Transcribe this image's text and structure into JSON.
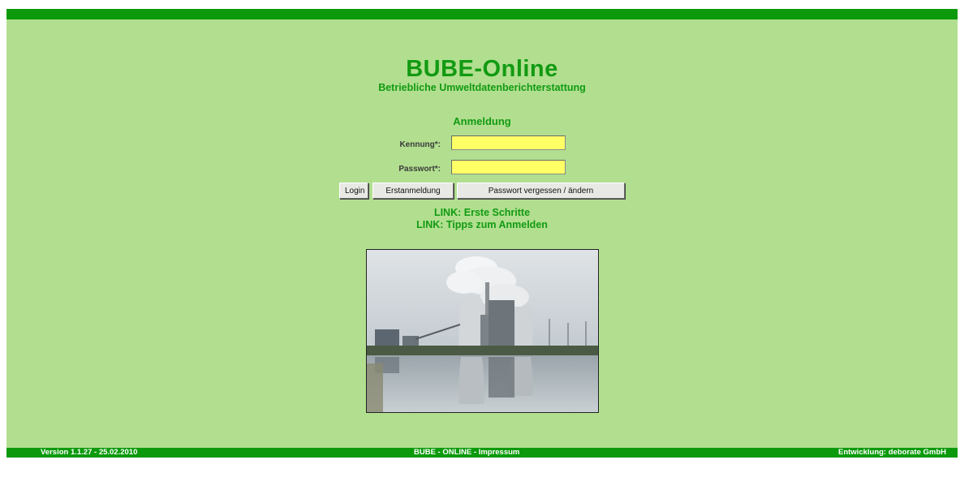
{
  "header": {
    "title": "BUBE-Online",
    "subtitle": "Betriebliche Umweltdatenberichterstattung"
  },
  "login": {
    "heading": "Anmeldung",
    "kennung_label": "Kennung*:",
    "kennung_value": "",
    "passwort_label": "Passwort*:",
    "passwort_value": "",
    "login_button": "Login",
    "erstanmeldung_button": "Erstanmeldung",
    "passwort_button": "Passwort vergessen / ändern"
  },
  "links": {
    "erste_schritte": "LINK: Erste Schritte",
    "tipps": "LINK: Tipps zum Anmelden"
  },
  "footer": {
    "version": "Version 1.1.27 - 25.02.2010",
    "impressum": "BUBE - ONLINE - Impressum",
    "entwicklung": "Entwicklung: deborate GmbH"
  },
  "colors": {
    "background": "#b1df8f",
    "bar": "#0c9a0c",
    "accent_text": "#129a12",
    "input_bg": "#ffff66"
  }
}
